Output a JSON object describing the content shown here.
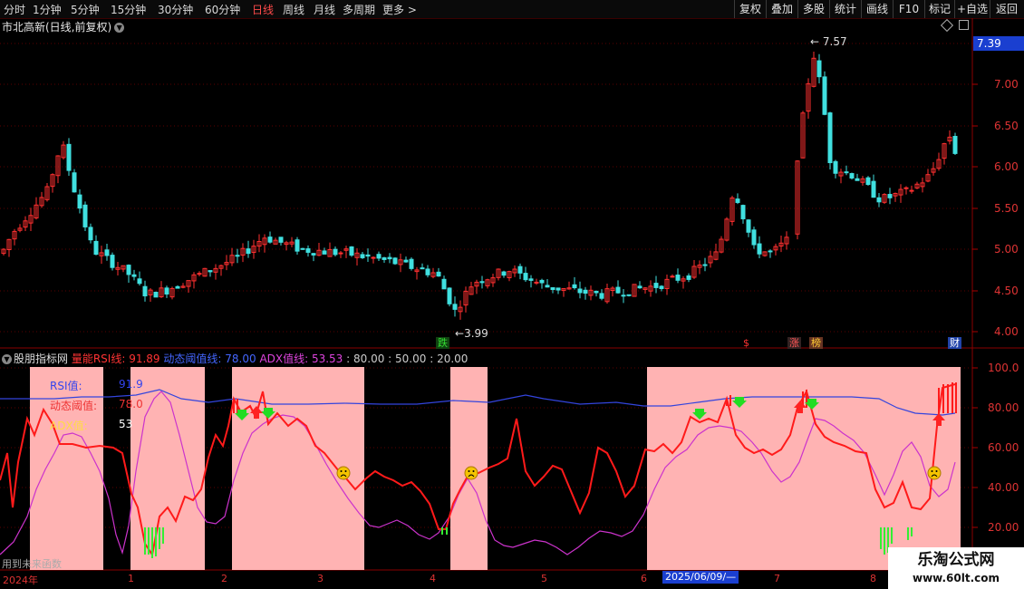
{
  "toolbar": {
    "periods": [
      {
        "label": "分时",
        "active": false
      },
      {
        "label": "1分钟",
        "active": false
      },
      {
        "label": "5分钟",
        "active": false
      },
      {
        "label": "15分钟",
        "active": false
      },
      {
        "label": "30分钟",
        "active": false
      },
      {
        "label": "60分钟",
        "active": false
      },
      {
        "label": "日线",
        "active": true
      },
      {
        "label": "周线",
        "active": false
      },
      {
        "label": "月线",
        "active": false
      },
      {
        "label": "多周期",
        "active": false
      },
      {
        "label": "更多 >",
        "active": false
      }
    ],
    "right_buttons": [
      "复权",
      "叠加",
      "多股",
      "统计",
      "画线",
      "F10",
      "标记",
      "+自选",
      "返回"
    ]
  },
  "main": {
    "title": "市北高新(日线,前复权)",
    "current_price": "7.39",
    "y_ticks": [
      "7.00",
      "6.50",
      "6.00",
      "5.50",
      "5.00",
      "4.50",
      "4.00"
    ],
    "high_label": "7.57",
    "low_label": "3.99",
    "tags": [
      {
        "text": "跌",
        "color": "#33dd33"
      },
      {
        "text": "$",
        "color": "#ff3333"
      },
      {
        "text": "涨",
        "color": "#ff5555"
      },
      {
        "text": "榜",
        "color": "#ffcc33"
      },
      {
        "text": "财",
        "color": "#ffffff"
      }
    ]
  },
  "indicator": {
    "name": "股朋指标网",
    "l1": "量能RSI线: 91.89",
    "l2": "动态阈值线: 78.00",
    "l3": "ADX值线: 53.53",
    "l4": ": 80.00 : 50.00 : 20.00",
    "y_ticks": [
      "100.0",
      "80.00",
      "60.00",
      "40.00",
      "20.00"
    ],
    "legend": [
      {
        "label": "RSI值:",
        "value": "91.9"
      },
      {
        "label": "动态阈值:",
        "value": "78.0"
      },
      {
        "label": "ADX值:",
        "value": "53"
      }
    ],
    "note": "用到未来函数"
  },
  "xaxis": {
    "labels": [
      "2024年",
      "1",
      "2",
      "3",
      "4",
      "5",
      "6",
      "7",
      "8"
    ],
    "cursor": "2025/06/09/—"
  },
  "watermark": {
    "line1": "乐淘公式网",
    "line2": "www.60lt.com"
  },
  "colors": {
    "up": "#ff3030",
    "down": "#40e0e0",
    "rsi": "#ff1a1a",
    "threshold": "#3344dd",
    "adx": "#cc33cc",
    "zone": "#ffb3b3",
    "green_bar": "#33ee33"
  }
}
